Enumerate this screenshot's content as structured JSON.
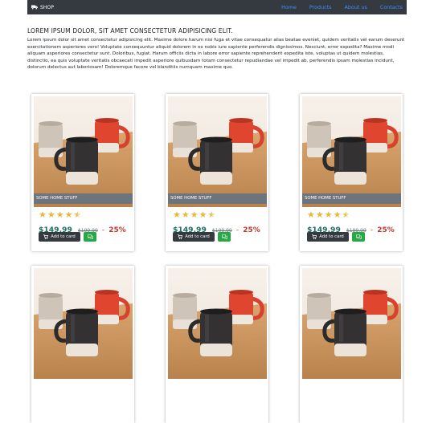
{
  "navbar": {
    "brand": "SHOP",
    "brand_icon": "truck-icon",
    "links": [
      "Home",
      "Products",
      "About us",
      "Contacts"
    ],
    "link_color": "#3b8dff"
  },
  "intro": {
    "title": "LOREM IPSUM DOLOR, SIT AMET CONSECTETUR ADIPISICING ELIT.",
    "text": "Lorem ipsum dolor sit amet consectetur adipisicing elit. Maxime dolore harum nisi fuga et vitae consequatur alias beatae eveniet, quidem veritatis vel earum deserunt exercitationem asperiores vero! Voluptate consequuntur aliquid dolorem in ex nobis iure sapiente perferendis dignissimos. Nesciunt, error expedita? Maxime modi aliquam asperiores consectetur sunt. Doloribus, fugiat. Harum officiis dicta in labore error sapiente reprehenderit expedita iste, voluptas ut quidem molestias, distinctio, ea quis voluptate veritatis obcaecati impedit asperiore quibusdam totam consectetur repudiandae vel impedit ab, perferendis ipsam molestias incidunt, dolorum delectus aut laboriosam! Doloremque facere vel blanditiis numquam maxime quo."
  },
  "products": [
    {
      "caption": "SOME HOME STUFF",
      "rating": 4.5,
      "price": "$149.99",
      "old_price": "$199.99",
      "separator": "-",
      "discount": "25%",
      "cart_label": "Add to card"
    },
    {
      "caption": "SOME HOME STUFF",
      "rating": 4.5,
      "price": "$149.99",
      "old_price": "$199.99",
      "separator": "-",
      "discount": "25%",
      "cart_label": "Add to card"
    },
    {
      "caption": "SOME HOME STUFF",
      "rating": 4.5,
      "price": "$149.99",
      "old_price": "$199.99",
      "separator": "-",
      "discount": "25%",
      "cart_label": "Add to card"
    }
  ],
  "colors": {
    "navbar": "#343a40",
    "price": "#1f6f63",
    "discount": "#c0392b",
    "star": "#e8b73b",
    "cart_button": "#343a40",
    "chat_button": "#28a745",
    "caption_bar": "#6c757d"
  }
}
